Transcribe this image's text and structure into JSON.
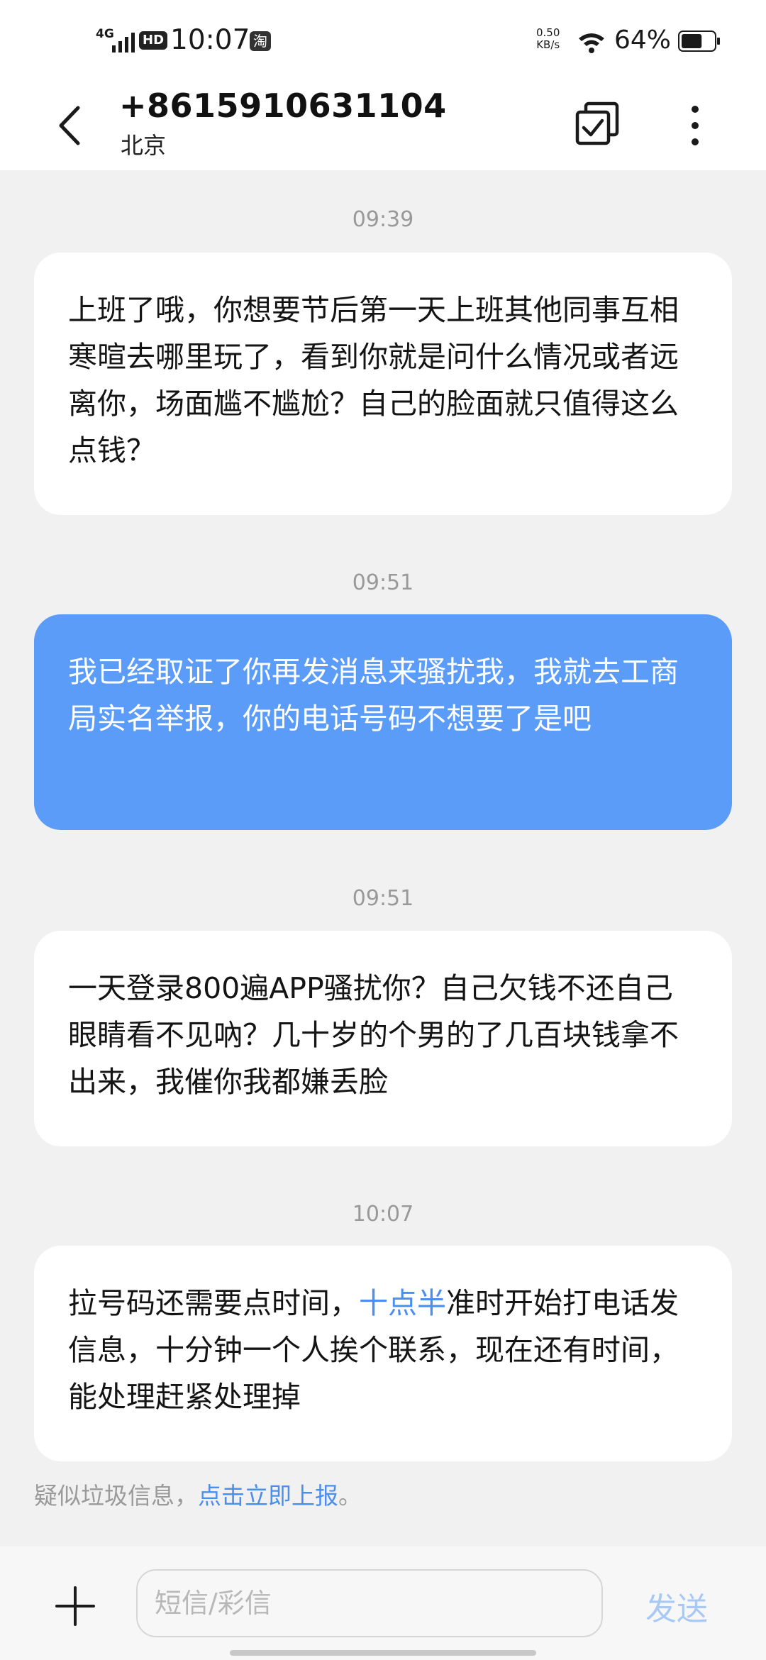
{
  "status_bar": {
    "network": "4G",
    "hd": "HD",
    "time": "10:07",
    "taobao": "淘",
    "speed_value": "0.50",
    "speed_unit": "KB/s",
    "battery_percent": "64%",
    "battery_level": 0.64
  },
  "header": {
    "contact_number": "+8615910631104",
    "region": "北京"
  },
  "messages": [
    {
      "time": "09:39",
      "direction": "incoming",
      "text": "上班了哦，你想要节后第一天上班其他同事互相寒暄去哪里玩了，看到你就是问什么情况或者远离你，场面尴不尴尬？自己的脸面就只值得这么点钱？"
    },
    {
      "time": "09:51",
      "direction": "outgoing",
      "text": "我已经取证了你再发消息来骚扰我，我就去工商局实名举报，你的电话号码不想要了是吧"
    },
    {
      "time": "09:51",
      "direction": "incoming",
      "text": "一天登录800遍APP骚扰你？自己欠钱不还自己眼睛看不见吶？几十岁的个男的了几百块钱拿不出来，我催你我都嫌丢脸"
    },
    {
      "time": "10:07",
      "direction": "incoming",
      "text_before": "拉号码还需要点时间，",
      "highlight": "十点半",
      "text_after": "准时开始打电话发信息，十分钟一个人挨个联系，现在还有时间，能处理赶紧处理掉"
    }
  ],
  "spam_notice": {
    "text": "疑似垃圾信息，",
    "link": "点击立即上报",
    "suffix": "。"
  },
  "composer": {
    "placeholder": "短信/彩信",
    "send_label": "发送"
  },
  "colors": {
    "outgoing_bubble": "#5a9cf8",
    "link": "#4a8ff0",
    "send_disabled": "#a9c9f4"
  }
}
